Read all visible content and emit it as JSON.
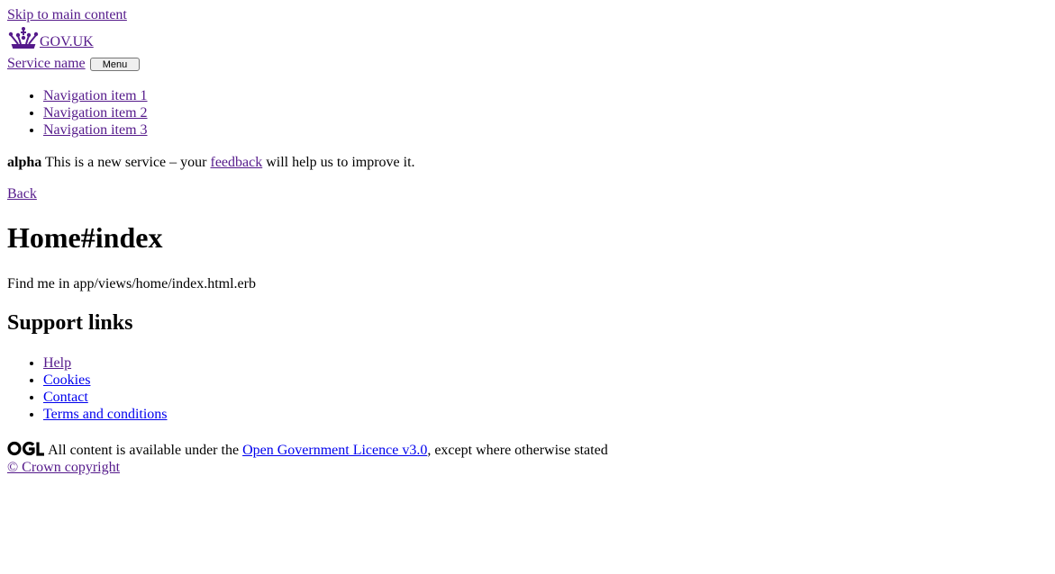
{
  "skip_link": "Skip to main content",
  "header": {
    "logo_text": "GOV.UK",
    "crown_icon": "crown-icon",
    "service_name": "Service name",
    "menu_button": "Menu",
    "nav": [
      "Navigation item 1",
      "Navigation item 2",
      "Navigation item 3"
    ]
  },
  "phase_banner": {
    "tag": "alpha",
    "text_before": "This is a new service – your",
    "link": "feedback",
    "text_after": "will help us to improve it."
  },
  "back_link": "Back",
  "main": {
    "title": "Home#index",
    "body": "Find me in app/views/home/index.html.erb"
  },
  "footer": {
    "support_heading": "Support links",
    "support_links": [
      "Help",
      "Cookies",
      "Contact",
      "Terms and conditions"
    ],
    "ogl_icon": "ogl-logo-icon",
    "licence_before": "All content is available under the",
    "licence_link": "Open Government Licence v3.0",
    "licence_after": ", except where otherwise stated",
    "copyright": "© Crown copyright"
  }
}
